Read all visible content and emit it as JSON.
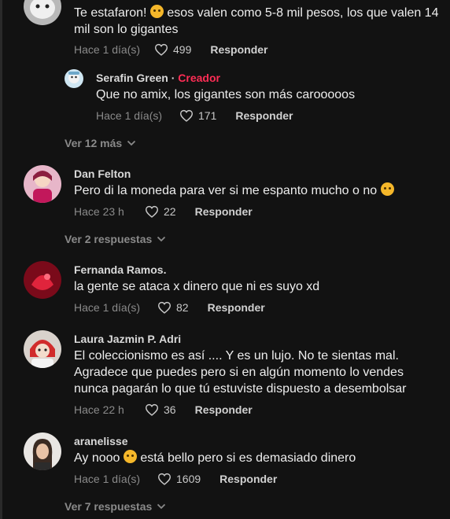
{
  "comments": [
    {
      "author": "",
      "text": "Te estafaron! {e} esos valen como 5-8 mil pesos, los que valen 14 mil son lo gigantes",
      "text_line1_a": "Te estafaron! ",
      "text_line1_b": " esos valen como 5-8 mil pesos, los que valen 14",
      "text_line2": "mil son lo gigantes",
      "time": "Hace 1 día(s)",
      "likes": "499",
      "reply_label": "Responder"
    },
    {
      "author": "Serafin Green",
      "creator_label": "Creador",
      "separator": "·",
      "text": "Que no amix, los gigantes son más carooooos",
      "time": "Hace 1 día(s)",
      "likes": "171",
      "reply_label": "Responder"
    },
    {
      "author": "Dan Felton",
      "text": "Pero di la moneda para ver si me espanto mucho o no",
      "time": "Hace 23 h",
      "likes": "22",
      "reply_label": "Responder"
    },
    {
      "author": "Fernanda Ramos.",
      "text": "la gente se ataca x dinero que ni es suyo xd",
      "time": "Hace 1 día(s)",
      "likes": "82",
      "reply_label": "Responder"
    },
    {
      "author": "Laura Jazmin P. Adri",
      "text_line1": "El coleccionismo es así .... Y es un lujo. No te sientas mal.",
      "text_line2": "Agradece que puedes pero si en algún momento lo vendes",
      "text_line3": "nunca pagarán lo que tú estuviste dispuesto a desembolsar",
      "time": "Hace 22 h",
      "likes": "36",
      "reply_label": "Responder"
    },
    {
      "author": "aranelisse",
      "text_a": "Ay nooo ",
      "text_b": " está bello pero si es demasiado dinero",
      "time": "Hace 1 día(s)",
      "likes": "1609",
      "reply_label": "Responder"
    }
  ],
  "more_links": {
    "first": "Ver 12 más",
    "second": "Ver 2 respuestas",
    "third": "Ver 7 respuestas"
  },
  "icons": {
    "like": "heart-outline-icon",
    "expand": "chevron-down-icon"
  },
  "colors": {
    "background": "#121212",
    "creator": "#ff2d55",
    "muted": "#8a8a8a"
  }
}
